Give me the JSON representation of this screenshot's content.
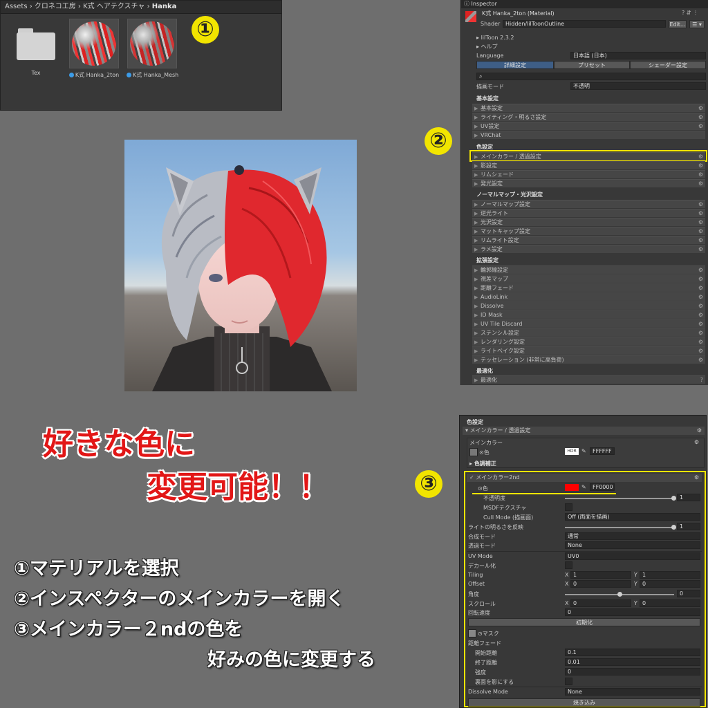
{
  "project": {
    "breadcrumb": [
      "Assets",
      "クロネコ工房",
      "K式  ヘアテクスチャ",
      "Hanka"
    ],
    "items": [
      {
        "type": "folder",
        "name": "Tex"
      },
      {
        "type": "material",
        "name": "K式 Hanka_2ton",
        "icon": "material-sphere-icon"
      },
      {
        "type": "material",
        "name": "K式 Hanka_Mesh",
        "icon": "material-sphere-icon"
      }
    ]
  },
  "markers": {
    "one": "①",
    "two": "②",
    "three": "③"
  },
  "inspector": {
    "tab": "Inspector",
    "material_title": "K式  Hanka_2ton (Material)",
    "shader_label": "Shader",
    "shader_value": "Hidden/lilToonOutline",
    "edit_label": "Edit...",
    "version": "lilToon 2.3.2",
    "help": "ヘルプ",
    "language_label": "Language",
    "language_value": "日本語 (日本)",
    "tabs": [
      "詳細設定",
      "プリセット",
      "シェーダー設定"
    ],
    "render_mode_label": "描画モード",
    "render_mode_value": "不透明",
    "sections": [
      {
        "title": "基本設定",
        "items": [
          "基本設定",
          "ライティング・明るさ設定",
          "UV設定",
          "VRChat"
        ]
      },
      {
        "title": "色設定",
        "items": [
          "メインカラー / 透過設定",
          "影設定",
          "リムシェード",
          "発光設定"
        ]
      },
      {
        "title": "ノーマルマップ・光沢設定",
        "items": [
          "ノーマルマップ設定",
          "逆光ライト",
          "光沢設定",
          "マットキャップ設定",
          "リムライト設定",
          "ラメ設定"
        ]
      },
      {
        "title": "拡張設定",
        "items": [
          "輪郭線設定",
          "視差マップ",
          "距離フェード",
          "AudioLink",
          "Dissolve",
          "ID Mask",
          "UV Tile Discard",
          "ステンシル設定",
          "レンダリング設定",
          "ライトベイク設定",
          "テッセレーション (非常に高負荷)"
        ]
      },
      {
        "title": "最適化",
        "items": [
          "最適化"
        ]
      }
    ]
  },
  "lower": {
    "section_title": "色設定",
    "header": "メインカラー / 透過設定",
    "main_color_box": "メインカラー",
    "color_label": "⊙色",
    "hdr": "HDR",
    "main_color_hex": "FFFFFF",
    "color_correction": "色調補正",
    "second_title": "メインカラー2nd",
    "second_color_label": "⊙色",
    "second_color_hex": "FF0000",
    "opacity_label": "不透明度",
    "opacity_value": "1",
    "msdf_label": "MSDFテクスチャ",
    "cull_label": "Cull Mode (描画面)",
    "cull_value": "Off (両面を描画)",
    "light_label": "ライトの明るさを反映",
    "light_value": "1",
    "blend_label": "合成モード",
    "blend_value": "通常",
    "alpha_label": "透過モード",
    "alpha_value": "None",
    "uvmode_label": "UV Mode",
    "uvmode_value": "UV0",
    "decal_label": "デカール化",
    "tiling_label": "Tiling",
    "tiling_x": "1",
    "tiling_y": "1",
    "offset_label": "Offset",
    "offset_x": "0",
    "offset_y": "0",
    "angle_label": "角度",
    "angle_value": "0",
    "scroll_label": "スクロール",
    "scroll_x": "0",
    "scroll_y": "0",
    "rotate_label": "回転速度",
    "rotate_value": "0",
    "reset_button": "初期化",
    "mask_label": "⊙マスク",
    "distance_fade": "距離フェード",
    "fade_start_label": "開始距離",
    "fade_start_value": "0.1",
    "fade_end_label": "終了距離",
    "fade_end_value": "0.01",
    "strength_label": "強度",
    "strength_value": "0",
    "backface_label": "裏面を影にする",
    "dissolve_label": "Dissolve Mode",
    "dissolve_value": "None",
    "bake_button": "焼き込み",
    "x_label": "X",
    "y_label": "Y"
  },
  "headline": {
    "line1": "好きな色に",
    "line2": "変更可能！！"
  },
  "instructions": [
    "①マテリアルを選択",
    "②インスペクターのメインカラーを開く",
    "③メインカラー２ndの色を",
    "好みの色に変更する"
  ],
  "colors": {
    "highlight": "#f2e500",
    "headline_red": "#e21616",
    "second_color": "#ff0000"
  }
}
